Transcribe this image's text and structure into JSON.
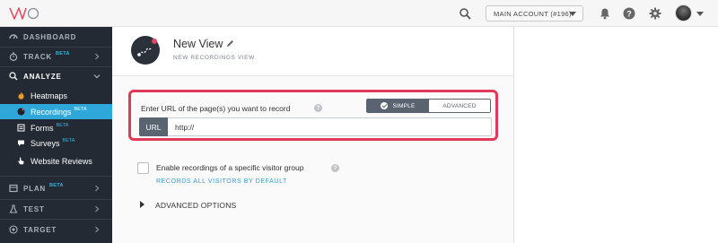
{
  "topbar": {
    "account_label": "MAIN ACCOUNT (#196)"
  },
  "sidebar": {
    "dashboard": {
      "label": "DASHBOARD"
    },
    "track": {
      "label": "TRACK",
      "badge": "BETA"
    },
    "analyze": {
      "label": "ANALYZE",
      "items": [
        {
          "label": "Heatmaps",
          "badge": ""
        },
        {
          "label": "Recordings",
          "badge": "BETA"
        },
        {
          "label": "Forms",
          "badge": "BETA"
        },
        {
          "label": "Surveys",
          "badge": "BETA"
        },
        {
          "label": "Website Reviews",
          "badge": ""
        }
      ]
    },
    "plan": {
      "label": "PLAN",
      "badge": "BETA"
    },
    "test": {
      "label": "TEST"
    },
    "target": {
      "label": "TARGET"
    }
  },
  "header": {
    "title": "New View",
    "subtitle": "NEW RECORDINGS VIEW"
  },
  "url_section": {
    "prompt": "Enter URL of the page(s) you want to record",
    "toggle": {
      "simple": "SIMPLE",
      "advanced": "ADVANCED"
    },
    "url_label": "URL",
    "url_value": "http://"
  },
  "visitor_group": {
    "label": "Enable recordings of a specific visitor group",
    "link": "RECORDS ALL VISITORS BY DEFAULT"
  },
  "advanced_options": {
    "label": "ADVANCED OPTIONS"
  },
  "colors": {
    "sidebar_bg": "#242a33",
    "active_item": "#2fa7d8",
    "highlight_border": "#e03a5b",
    "toggle_active": "#5a6470",
    "link": "#2f9fd1",
    "badge": "#2fb4e0"
  }
}
